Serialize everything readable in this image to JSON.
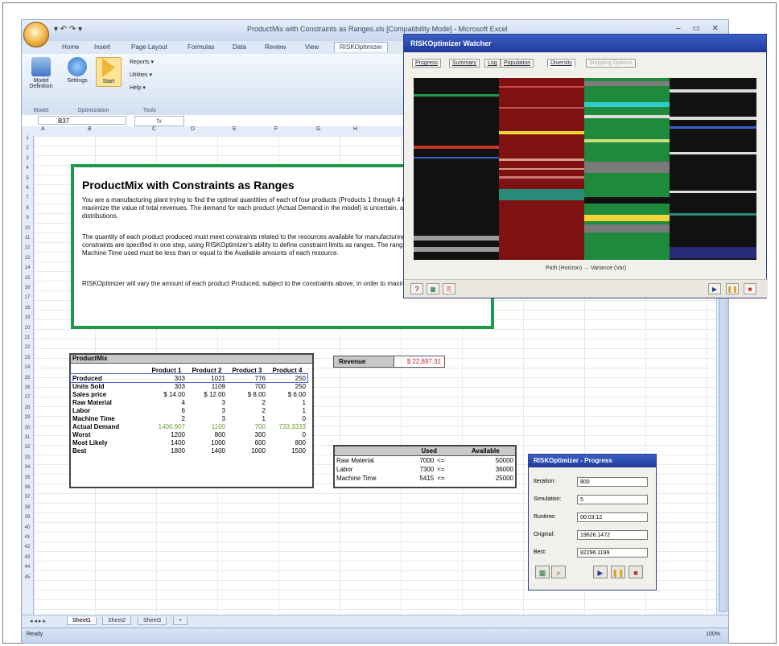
{
  "window": {
    "title": "ProductMix with Constraints as Ranges.xls [Compatibility Mode] - Microsoft Excel",
    "qat": "▾ ↶ ↷ ▾",
    "controls": "– ▭ ✕"
  },
  "ribbon": {
    "tabs": [
      "Home",
      "Insert",
      "Page Layout",
      "Formulas",
      "Data",
      "Review",
      "View",
      "RISKOptimizer"
    ],
    "active_tab": "RISKOptimizer",
    "buttons": {
      "model_definition": "Model Definition",
      "settings": "Settings",
      "start": "Start",
      "reports": "Reports ▾",
      "utilities": "Utilities ▾",
      "help": "Help ▾"
    },
    "groups": {
      "model": "Model",
      "optimization": "Optimization",
      "tools": "Tools"
    }
  },
  "formula_bar": {
    "name_box": "B37",
    "fx": "fx"
  },
  "column_headers": [
    "A",
    "B",
    "C",
    "D",
    "E",
    "F",
    "G",
    "H"
  ],
  "row_headers": [
    "1",
    "2",
    "3",
    "4",
    "5",
    "6",
    "7",
    "8",
    "9",
    "10",
    "11",
    "12",
    "13",
    "14",
    "15",
    "16",
    "17",
    "18",
    "19",
    "20",
    "21",
    "22",
    "23",
    "24",
    "25",
    "26",
    "27",
    "28",
    "29",
    "30",
    "31",
    "32",
    "33",
    "34",
    "35",
    "36",
    "37",
    "38",
    "39",
    "40",
    "41",
    "42",
    "43",
    "44",
    "45"
  ],
  "description": {
    "title": "ProductMix with Constraints as Ranges",
    "p1": "You are a manufacturing plant trying to find the optimal quantities of each of four products (Products 1 through 4 in the Produced row) to maximize the value of total revenues. The demand for each product (Actual Demand in the model) is uncertain, and represented with probability distributions.",
    "p2": "The quantity of each product produced must meet constraints related to the resources available for manufacturing each product. Here, all constraints are specified in one step, using RISKOptimizer's ability to define constraint limits as ranges. The range of Raw Material, Labor, and Machine Time used must be less than or equal to the Available amounts of each resource.",
    "p3": "RISKOptimizer will vary the amount of each product Produced, subject to the constraints above, in order to maximize Revenues."
  },
  "product_mix": {
    "header": "ProductMix",
    "columns": [
      "Product 1",
      "Product 2",
      "Product 3",
      "Product 4"
    ],
    "rows": [
      {
        "label": "Produced",
        "values": [
          "303",
          "1021",
          "776",
          "250"
        ]
      },
      {
        "label": "Units Sold",
        "values": [
          "303",
          "1109",
          "700",
          "250"
        ]
      },
      {
        "label": "Sales price",
        "values": [
          "$ 14.00",
          "$ 12.00",
          "$ 8.00",
          "$ 6.00"
        ]
      },
      {
        "label": "Raw Material",
        "values": [
          "4",
          "3",
          "2",
          "1"
        ]
      },
      {
        "label": "Labor",
        "values": [
          "6",
          "3",
          "2",
          "1"
        ]
      },
      {
        "label": "Machine Time",
        "values": [
          "2",
          "3",
          "1",
          "0"
        ]
      },
      {
        "label": "Actual Demand",
        "values": [
          "1400.907",
          "1100",
          "700",
          "733.3333"
        ]
      },
      {
        "label": "Worst",
        "values": [
          "1200",
          "800",
          "300",
          "0"
        ]
      },
      {
        "label": "Most Likely",
        "values": [
          "1400",
          "1000",
          "600",
          "800"
        ]
      },
      {
        "label": "Best",
        "values": [
          "1800",
          "1400",
          "1000",
          "1500"
        ]
      }
    ]
  },
  "revenue": {
    "label": "Revenue",
    "value": "$ 22,897.31"
  },
  "resources": {
    "headers": [
      "Used",
      "",
      "Available"
    ],
    "rows": [
      {
        "label": "Raw Material",
        "used": "7000",
        "op": "<=",
        "available": "50000"
      },
      {
        "label": "Labor",
        "used": "7300",
        "op": "<=",
        "available": "36000"
      },
      {
        "label": "Machine Time",
        "used": "5415",
        "op": "<=",
        "available": "25000"
      }
    ]
  },
  "progress": {
    "title": "RISKOptimizer - Progress",
    "fields": [
      {
        "label": "Iteration:",
        "value": "800"
      },
      {
        "label": "Simulation:",
        "value": "5"
      },
      {
        "label": "Runtime:",
        "value": "00:03:12"
      },
      {
        "label": "Original:",
        "value": "19626.1472"
      },
      {
        "label": "Best:",
        "value": "82296.1199"
      }
    ]
  },
  "watcher": {
    "title": "RISKOptimizer Watcher",
    "tabs": [
      "Progress",
      "Summary",
      "Log",
      "Population",
      "Diversity",
      "Stopping Options"
    ],
    "active_tab": "Diversity",
    "caption": "Path (Horizon) → Variance (Var)"
  },
  "sheet_tabs": [
    "Sheet1",
    "Sheet2",
    "Sheet3"
  ],
  "status": {
    "ready": "Ready",
    "zoom": "100%"
  },
  "colors": {
    "accent_green": "#1f9a4a",
    "title_blue": "#1f3a9a",
    "red": "#c62a2a"
  }
}
